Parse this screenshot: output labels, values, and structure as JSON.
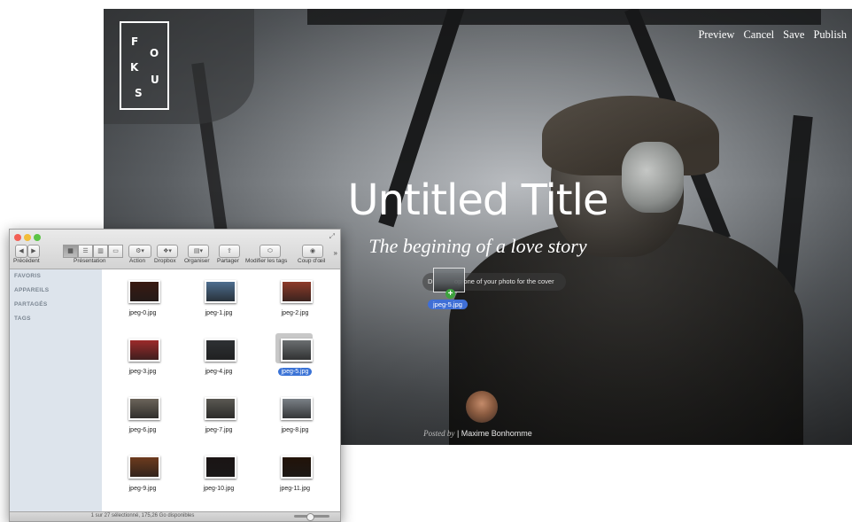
{
  "editor": {
    "logo_letters": [
      "F",
      "O",
      "K",
      "U",
      "S"
    ],
    "nav": {
      "preview": "Preview",
      "cancel": "Cancel",
      "save": "Save",
      "publish": "Publish"
    },
    "title": "Untitled Title",
    "subtitle": "The begining of a love story",
    "dropzone": {
      "lead": "D",
      "text": "op one of your photo for the cover"
    },
    "drag_file": "jpeg-5.jpg",
    "posted_by_label": "Posted by",
    "author": "| Maxime Bonhomme"
  },
  "finder": {
    "toolbar": {
      "back": "◀",
      "forward": "▶",
      "labels": {
        "back": "Précédent",
        "view": "Présentation",
        "action": "Action",
        "dropbox": "Dropbox",
        "arrange": "Organiser",
        "share": "Partager",
        "tags": "Modifier les tags",
        "quicklook": "Coup d'œil"
      }
    },
    "sidebar": [
      "FAVORIS",
      "APPAREILS",
      "PARTAGÉS",
      "TAGS"
    ],
    "files": [
      {
        "name": "jpeg-0.jpg",
        "color": "#3a1a12"
      },
      {
        "name": "jpeg-1.jpg",
        "color": "#4e6e8f"
      },
      {
        "name": "jpeg-2.jpg",
        "color": "#8e3b2a"
      },
      {
        "name": "jpeg-3.jpg",
        "color": "#9c2a2a"
      },
      {
        "name": "jpeg-4.jpg",
        "color": "#2e3134"
      },
      {
        "name": "jpeg-5.jpg",
        "color": "#6a6e70"
      },
      {
        "name": "jpeg-6.jpg",
        "color": "#6b645a"
      },
      {
        "name": "jpeg-7.jpg",
        "color": "#5a5852"
      },
      {
        "name": "jpeg-8.jpg",
        "color": "#7a8086"
      },
      {
        "name": "jpeg-9.jpg",
        "color": "#6d3b1e"
      },
      {
        "name": "jpeg-10.jpg",
        "color": "#1a1414"
      },
      {
        "name": "jpeg-11.jpg",
        "color": "#221309"
      }
    ],
    "selected_index": 5,
    "status": "1 sur 27 sélectionné, 175,26 Go disponibles"
  }
}
